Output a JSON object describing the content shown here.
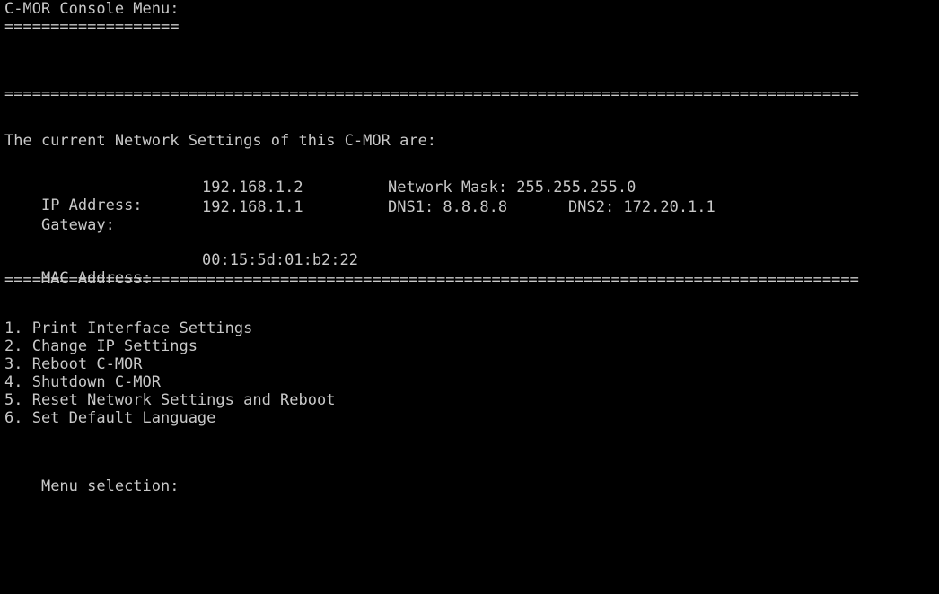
{
  "console": {
    "title": "C-MOR Console Menu:",
    "title_underline": "===================",
    "separator": "=============================================================================================",
    "settings_heading": "The current Network Settings of this C-MOR are:",
    "ip_label": "IP Address:",
    "ip_value": "192.168.1.2",
    "netmask_label_value": "Network Mask: 255.255.255.0",
    "gateway_label": "Gateway:",
    "gateway_value": "192.168.1.1",
    "dns1": "DNS1: 8.8.8.8",
    "dns2": "DNS2: 172.20.1.1",
    "mac_label": "MAC Address:",
    "mac_value": "00:15:5d:01:b2:22",
    "menu_items": [
      "1. Print Interface Settings",
      "2. Change IP Settings",
      "3. Reboot C-MOR",
      "4. Shutdown C-MOR",
      "5. Reset Network Settings and Reboot",
      "6. Set Default Language"
    ],
    "prompt": "Menu selection:"
  }
}
